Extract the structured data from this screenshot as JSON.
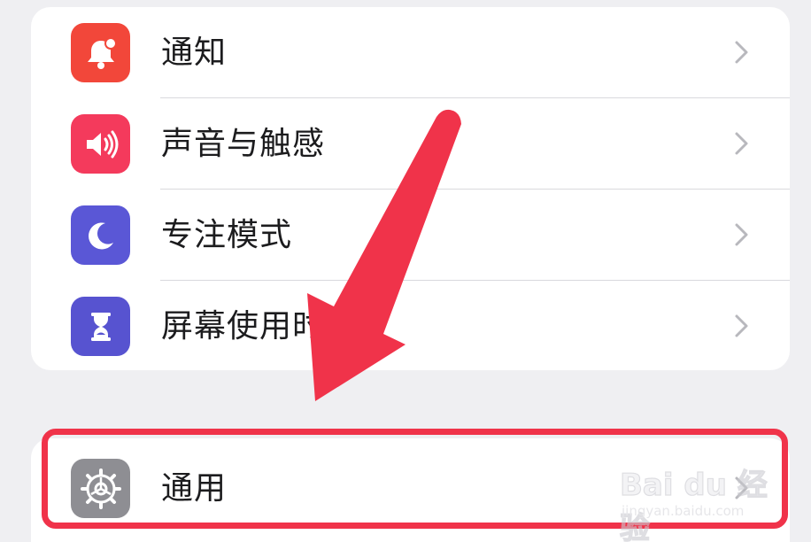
{
  "settings_group_1": {
    "items": [
      {
        "label": "通知",
        "icon": "notification-bell-icon",
        "icon_color": "#f2473a"
      },
      {
        "label": "声音与触感",
        "icon": "speaker-sound-icon",
        "icon_color": "#f43a5c"
      },
      {
        "label": "专注模式",
        "icon": "moon-icon",
        "icon_color": "#5a57d6"
      },
      {
        "label": "屏幕使用时间",
        "icon": "hourglass-icon",
        "icon_color": "#5753d0"
      }
    ]
  },
  "settings_group_2": {
    "items": [
      {
        "label": "通用",
        "icon": "gear-icon",
        "icon_color": "#8e8e93"
      }
    ]
  },
  "annotation": {
    "arrow_color": "#f0334a",
    "highlight_color": "#f0334a"
  },
  "watermark": {
    "main": "Bai du 经验",
    "sub": "jingyan.baidu.com"
  }
}
